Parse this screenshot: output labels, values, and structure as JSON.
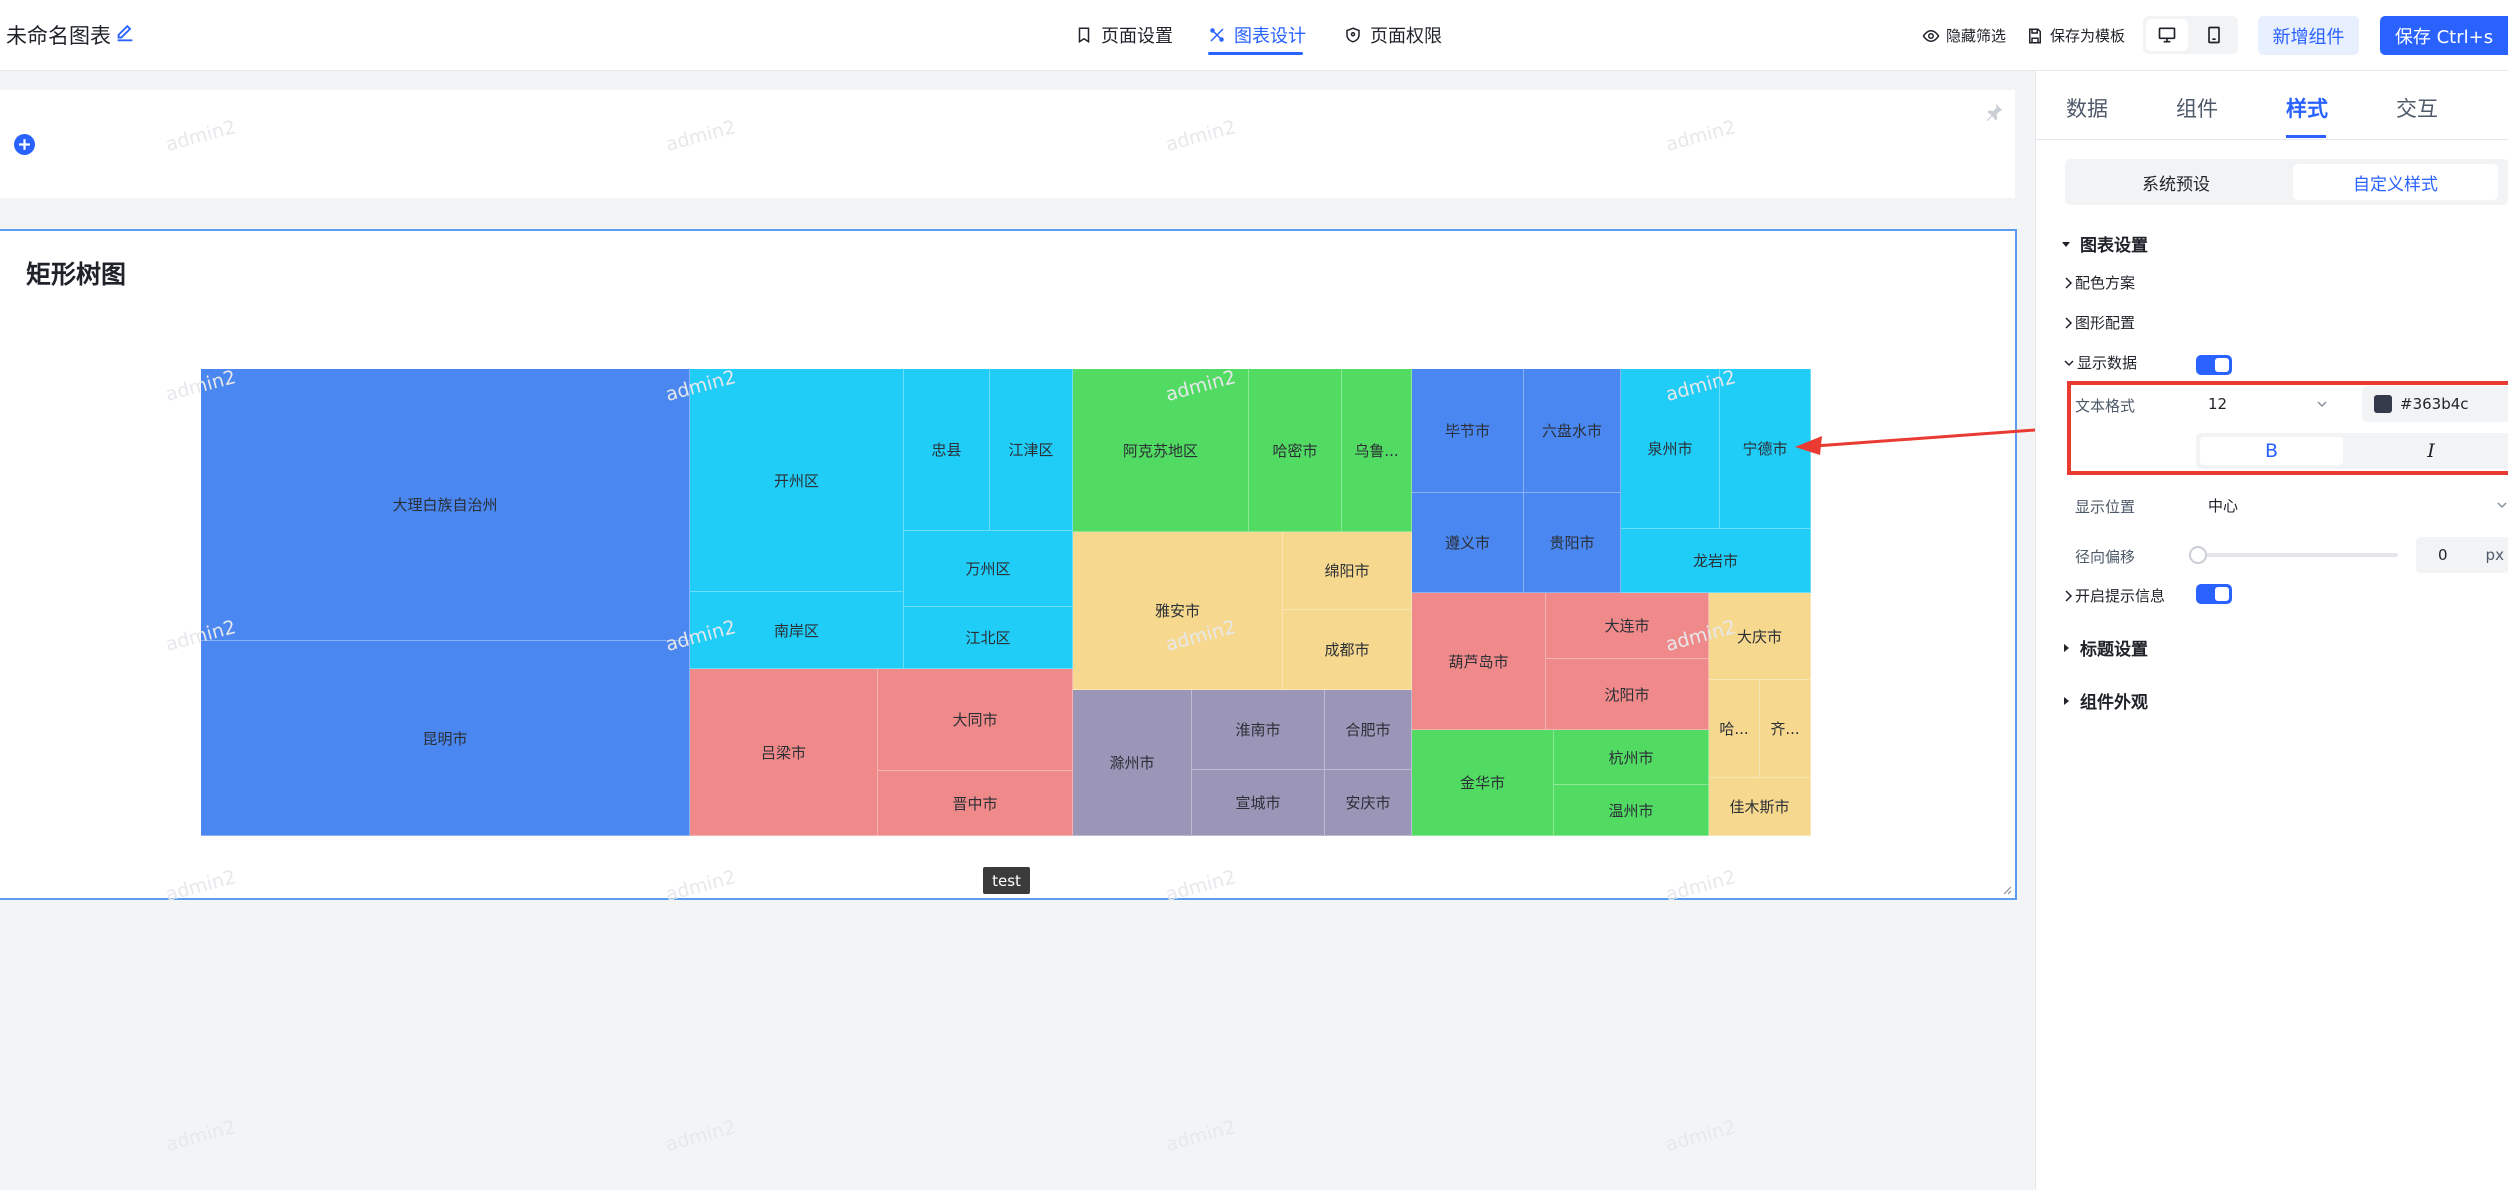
{
  "topbar": {
    "title": "未命名图表",
    "nav": [
      {
        "label": "页面设置",
        "icon": "bookmark-icon"
      },
      {
        "label": "图表设计",
        "icon": "design-icon",
        "active": true
      },
      {
        "label": "页面权限",
        "icon": "shield-icon"
      }
    ],
    "hide_filter": "隐藏筛选",
    "save_template": "保存为模板",
    "add_component": "新增组件",
    "save": "保存 Ctrl+s"
  },
  "watermark": "admin2",
  "chart": {
    "title": "矩形树图",
    "tooltip_label": "test",
    "colors": {
      "blue": "#4a87f0",
      "cyan": "#20cdf7",
      "green": "#52db62",
      "yellow": "#f6d88f",
      "red": "#f08a8a",
      "purple": "#9b96b8"
    }
  },
  "chart_data": {
    "type": "treemap",
    "title": "矩形树图",
    "groups": [
      {
        "color": "#4a87f0",
        "leaves": [
          "大理白族自治州",
          "昆明市"
        ]
      },
      {
        "color": "#20cdf7",
        "leaves": [
          "开州区",
          "忠县",
          "江津区",
          "万州区",
          "南岸区",
          "江北区"
        ]
      },
      {
        "color": "#52db62",
        "leaves": [
          "阿克苏地区",
          "哈密市",
          "乌鲁..."
        ]
      },
      {
        "color": "#f6d88f",
        "leaves": [
          "雅安市",
          "绵阳市",
          "成都市"
        ]
      },
      {
        "color": "#f08a8a",
        "leaves": [
          "吕梁市",
          "大同市",
          "晋中市"
        ]
      },
      {
        "color": "#9b96b8",
        "leaves": [
          "滁州市",
          "淮南市",
          "合肥市",
          "宣城市",
          "安庆市"
        ]
      },
      {
        "color": "#4a87f0",
        "leaves": [
          "毕节市",
          "六盘水市",
          "遵义市",
          "贵阳市"
        ]
      },
      {
        "color": "#20cdf7",
        "leaves": [
          "泉州市",
          "宁德市",
          "龙岩市"
        ]
      },
      {
        "color": "#f08a8a",
        "leaves": [
          "葫芦岛市",
          "大连市",
          "沈阳市"
        ]
      },
      {
        "color": "#52db62",
        "leaves": [
          "金华市",
          "杭州市",
          "温州市"
        ]
      },
      {
        "color": "#f6d88f",
        "leaves": [
          "大庆市",
          "哈...",
          "齐...",
          "佳木斯市"
        ]
      }
    ]
  },
  "panel": {
    "tabs": [
      "数据",
      "组件",
      "样式",
      "交互"
    ],
    "active_tab": "样式",
    "segments": [
      "系统预设",
      "自定义样式"
    ],
    "active_segment": "自定义样式",
    "sections": {
      "chart_settings": "图表设置",
      "title_settings": "标题设置",
      "component_look": "组件外观"
    },
    "items": {
      "color_scheme": "配色方案",
      "shape_config": "图形配置",
      "show_data": "显示数据",
      "text_format": "文本格式",
      "font_size": "12",
      "text_color": "#363b4c",
      "bold": "B",
      "italic": "I",
      "display_pos": "显示位置",
      "display_pos_value": "中心",
      "radial_offset": "径向偏移",
      "radial_offset_value": "0",
      "unit": "px",
      "tooltip": "开启提示信息"
    }
  }
}
